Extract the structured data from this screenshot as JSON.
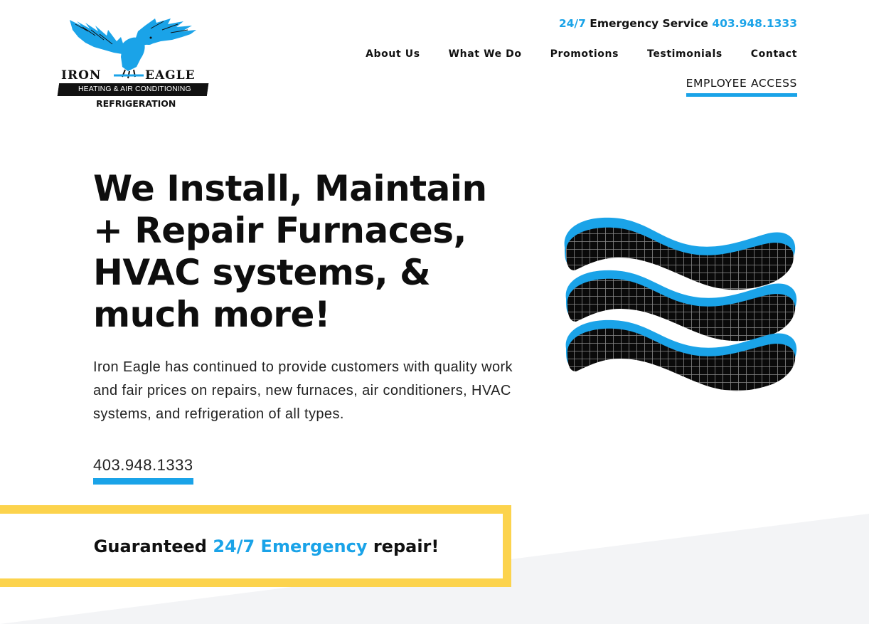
{
  "logo": {
    "word_left": "IRON",
    "word_right": "EAGLE",
    "band_text": "HEATING & AIR CONDITIONING",
    "sub_text": "REFRIGERATION"
  },
  "topbar": {
    "emergency_prefix": "24/7",
    "emergency_middle": "Emergency Service",
    "emergency_phone": "403.948.1333"
  },
  "nav": {
    "items": [
      {
        "label": "About Us"
      },
      {
        "label": "What We Do"
      },
      {
        "label": "Promotions"
      },
      {
        "label": "Testimonials"
      },
      {
        "label": "Contact"
      }
    ],
    "employee_access": "EMPLOYEE ACCESS"
  },
  "hero": {
    "headline": "We Install, Maintain + Repair Furnaces, HVAC systems, & much more!",
    "description": "Iron Eagle has continued to provide customers with quality work and fair prices on repairs, new furnaces, air conditioners, HVAC systems, and refrigeration of all types.",
    "phone": "403.948.1333"
  },
  "guarantee": {
    "before": "Guaranteed",
    "highlight": "24/7 Emergency",
    "after": "repair!"
  },
  "colors": {
    "accent_blue": "#1aa3e8",
    "accent_yellow": "#fcd34d",
    "text_dark": "#111111"
  },
  "icons": {
    "logo_mark": "eagle-icon",
    "hero_graphic": "air-waves-icon"
  }
}
